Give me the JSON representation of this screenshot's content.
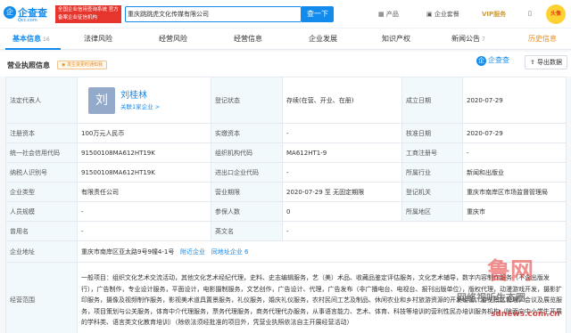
{
  "topbar": {
    "logo_glyph": "企",
    "logo_name": "企查查",
    "logo_url": "Qcc.com",
    "promo_text": "全国企业信用查询系统 官方备案企业征信机构",
    "search_value": "重庆跳跳虎文化传媒有限公司",
    "search_button": "查一下",
    "nav": [
      "产品",
      "企业套餐",
      "VIP服务"
    ],
    "avatar_text": "头像"
  },
  "tabs": [
    {
      "label": "基本信息",
      "count": "16"
    },
    {
      "label": "法律风险",
      "count": ""
    },
    {
      "label": "经营风险",
      "count": ""
    },
    {
      "label": "经营信息",
      "count": ""
    },
    {
      "label": "企业发展",
      "count": ""
    },
    {
      "label": "知识产权",
      "count": ""
    },
    {
      "label": "新闻公告",
      "count": "7"
    },
    {
      "label": "历史信息",
      "count": ""
    }
  ],
  "section": {
    "title": "营业执照信息",
    "badge": "发生变更时通知我",
    "watermark_glyph": "企",
    "watermark": "企查查",
    "export_label": "导出数据"
  },
  "legal_rep": {
    "label": "法定代表人",
    "avatar": "刘",
    "name": "刘桂林",
    "related": "关联1家企业 >"
  },
  "rows": {
    "reg_status_label": "登记状态",
    "reg_status": "存续(在营、开业、在册)",
    "est_date_label": "成立日期",
    "est_date": "2020-07-29",
    "reg_capital_label": "注册资本",
    "reg_capital": "100万元人民币",
    "paid_capital_label": "实缴资本",
    "paid_capital": "-",
    "approve_date_label": "核准日期",
    "approve_date": "2020-07-29",
    "credit_code_label": "统一社会信用代码",
    "credit_code": "91500108MA612HT19K",
    "org_code_label": "组织机构代码",
    "org_code": "MA612HT1-9",
    "biz_reg_label": "工商注册号",
    "biz_reg": "-",
    "taxpayer_label": "纳税人识别号",
    "taxpayer": "91500108MA612HT19K",
    "import_label": "进出口企业代码",
    "import_code": "-",
    "industry_label": "所属行业",
    "industry": "新闻和出版业",
    "type_label": "企业类型",
    "type": "有限责任公司",
    "term_label": "营业期限",
    "term": "2020-07-29 至 无固定期限",
    "authority_label": "登记机关",
    "authority": "重庆市南岸区市场监督管理局",
    "staff_label": "人员规模",
    "staff": "-",
    "insured_label": "参保人数",
    "insured": "0",
    "region_label": "所属地区",
    "region": "重庆市",
    "former_label": "曾用名",
    "former": "-",
    "en_label": "英文名",
    "en_name": "-",
    "address_label": "企业地址",
    "address": "重庆市南岸区亚太路9号9幢4-1号",
    "nearby": "附近企业",
    "same_addr": "同地址企业 6",
    "scope_label": "经营范围",
    "scope": "一般项目：组织文化艺术交流活动，其他文化艺术经纪代理，史料、史志编辑服务，艺（美）术品、收藏品鉴定评估服务，文化艺术辅导，数字内容制作服务（不含出版发行），广告制作，专业设计服务，平面设计，电影摄制服务，文艺创作，广告设计、代理，广告发布（非广播电台、电视台、报刊出版单位），版权代理，动漫游戏开发，摄影扩印服务，摄像及视频制作服务，影视美术道具置景服务，礼仪服务，婚庆礼仪服务，农村民间工艺及制品、休闲农业和乡村旅游资源的开发经营，游览景区管理，会议及展览服务，项目策划与公关服务，体育中介代理服务，票务代理服务，商务代理代办服务，从事语言能力、艺术、体育、科技等培训的营利性民办培训服务机构（除面向中小学生开展的学科类、语言类文化教育培训）（除依法须经批准的项目外，凭营业执照依法自主开展经营活动）"
  },
  "site_watermark": {
    "brand": "鲁网",
    "text": "网络视听生态圈",
    "url": "sdnews.com.cn"
  }
}
